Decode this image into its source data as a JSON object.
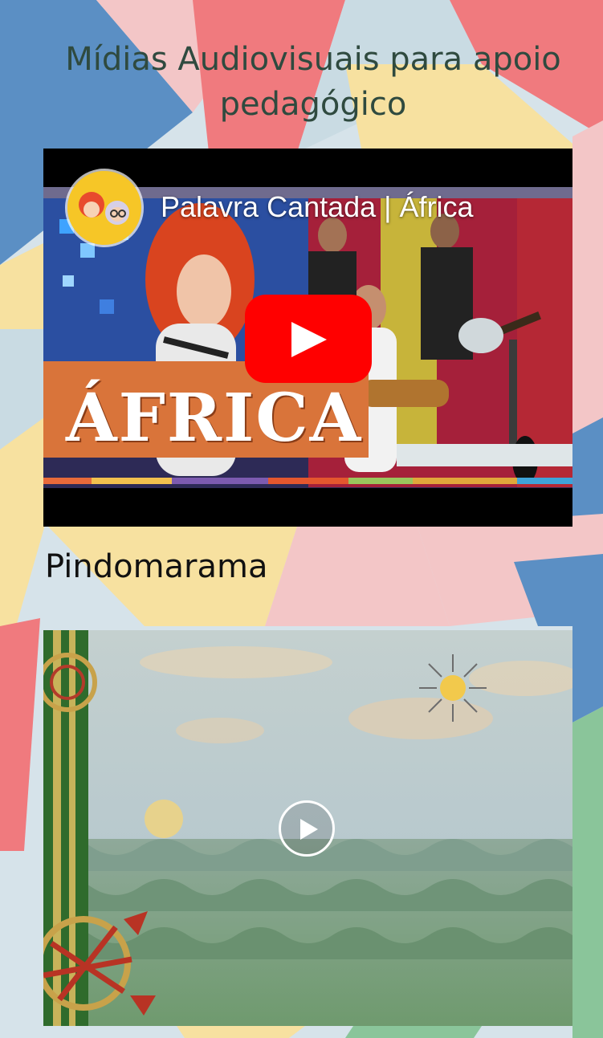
{
  "page": {
    "title": "Mídias Audiovisuais para apoio pedagógico"
  },
  "video1": {
    "title": "Palavra Cantada | África",
    "thumbnail_text": "ÁFRICA",
    "play_icon": "youtube-play-icon",
    "channel_icon": "channel-avatar-icon",
    "play_color": "#ff0000"
  },
  "section": {
    "title": "Pindomarama"
  },
  "video2": {
    "play_icon": "play-circle-icon"
  },
  "colors": {
    "background_blue": "#5b8fc4",
    "background_pink": "#f07a7e",
    "background_yellow": "#f7e1a0",
    "background_green": "#8ac59a",
    "title_color": "#2f4a3f"
  }
}
